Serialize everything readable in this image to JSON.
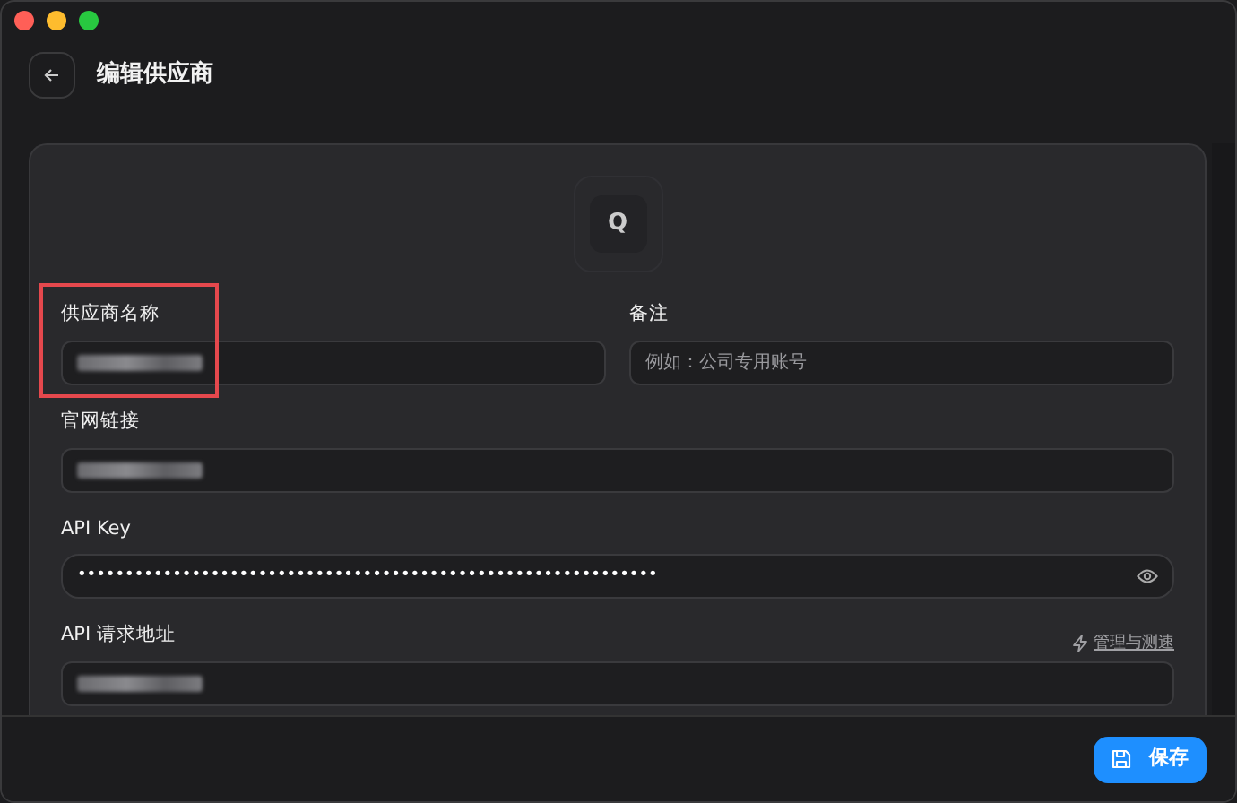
{
  "window": {
    "title": "编辑供应商"
  },
  "avatar": {
    "letter": "Q"
  },
  "fields": [
    {
      "label": "供应商名称",
      "kind": "redacted",
      "highlighted": true
    },
    {
      "label": "备注",
      "kind": "text",
      "placeholder": "例如：公司专用账号"
    },
    {
      "label": "官网链接",
      "kind": "redacted"
    },
    {
      "label": "API Key",
      "kind": "secret",
      "value": "•••••••••••••••••••••••••••••••••••••••••••••••••••••••••••••"
    },
    {
      "label": "API 请求地址",
      "kind": "redacted",
      "action": "管理与测速"
    }
  ],
  "buttons": [
    {
      "label": "保存"
    }
  ]
}
